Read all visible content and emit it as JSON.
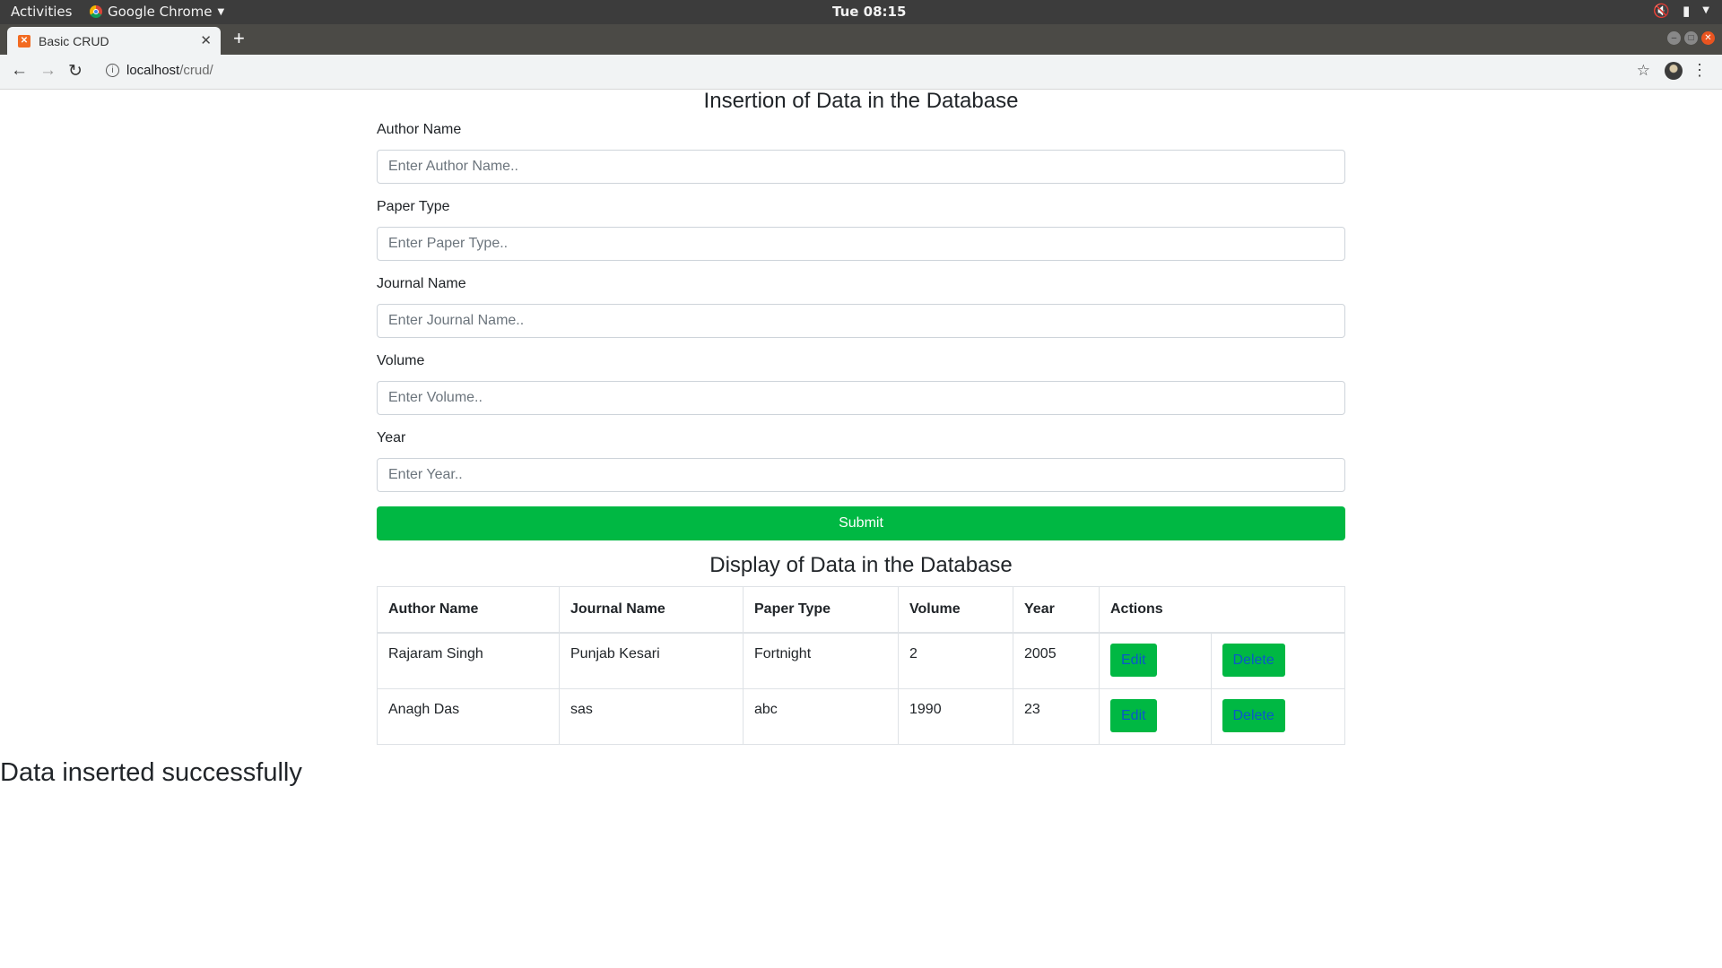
{
  "topbar": {
    "activities": "Activities",
    "app_name": "Google Chrome",
    "clock": "Tue 08:15"
  },
  "browser": {
    "tab_title": "Basic CRUD",
    "url_host": "localhost",
    "url_path": "/crud/"
  },
  "form": {
    "heading": "Insertion of Data in the Database",
    "fields": [
      {
        "label": "Author Name",
        "placeholder": "Enter Author Name..",
        "value": ""
      },
      {
        "label": "Paper Type",
        "placeholder": "Enter Paper Type..",
        "value": ""
      },
      {
        "label": "Journal Name",
        "placeholder": "Enter Journal Name..",
        "value": ""
      },
      {
        "label": "Volume",
        "placeholder": "Enter Volume..",
        "value": ""
      },
      {
        "label": "Year",
        "placeholder": "Enter Year..",
        "value": ""
      }
    ],
    "submit_label": "Submit"
  },
  "table": {
    "heading": "Display of Data in the Database",
    "columns": [
      "Author Name",
      "Journal Name",
      "Paper Type",
      "Volume",
      "Year",
      "Actions"
    ],
    "rows": [
      [
        "Rajaram Singh",
        "Punjab Kesari",
        "Fortnight",
        "2",
        "2005"
      ],
      [
        "Anagh Das",
        "sas",
        "abc",
        "1990",
        "23"
      ]
    ],
    "edit_label": "Edit",
    "delete_label": "Delete"
  },
  "message": "Data inserted successfully",
  "colors": {
    "accent_green": "#00b843",
    "action_text_blue": "#0a58ca"
  }
}
